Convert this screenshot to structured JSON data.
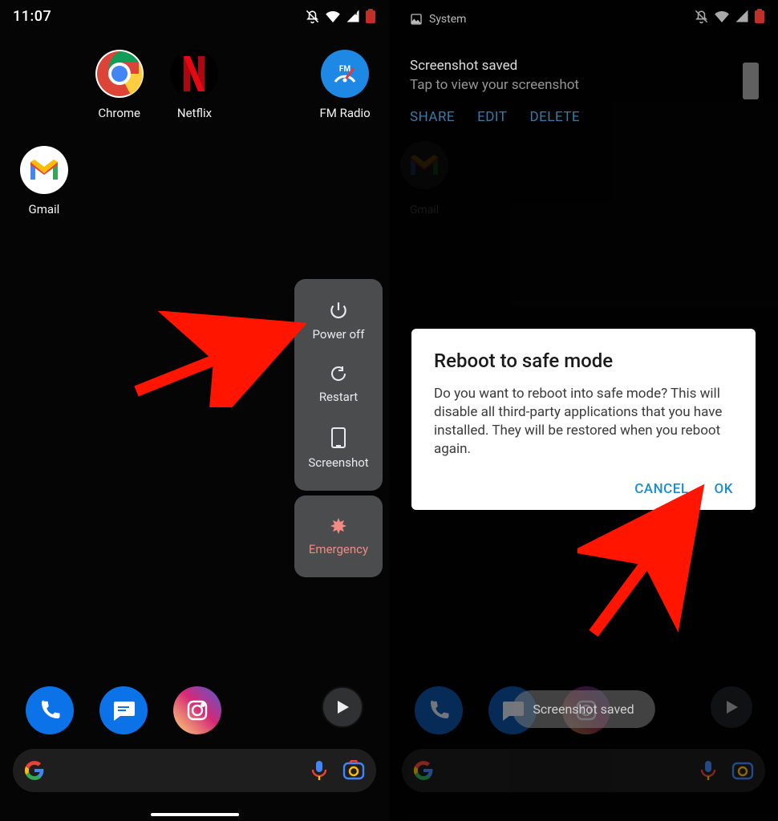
{
  "left": {
    "status_time": "11:07",
    "apps": {
      "chrome": "Chrome",
      "netflix": "Netflix",
      "fmradio": "FM Radio",
      "gmail": "Gmail"
    },
    "power_menu": {
      "power_off": "Power off",
      "restart": "Restart",
      "screenshot": "Screenshot",
      "emergency": "Emergency"
    }
  },
  "right": {
    "notif_app": "System",
    "notif_title": "Screenshot saved",
    "notif_body": "Tap to view your screenshot",
    "notif_actions": {
      "share": "SHARE",
      "edit": "EDIT",
      "delete": "DELETE"
    },
    "bg_gmail": "Gmail",
    "dialog": {
      "title": "Reboot to safe mode",
      "body": "Do you want to reboot into safe mode? This will disable all third-party applications that you have installed. They will be restored when you reboot again.",
      "cancel": "CANCEL",
      "ok": "OK"
    },
    "toast": "Screenshot saved"
  }
}
